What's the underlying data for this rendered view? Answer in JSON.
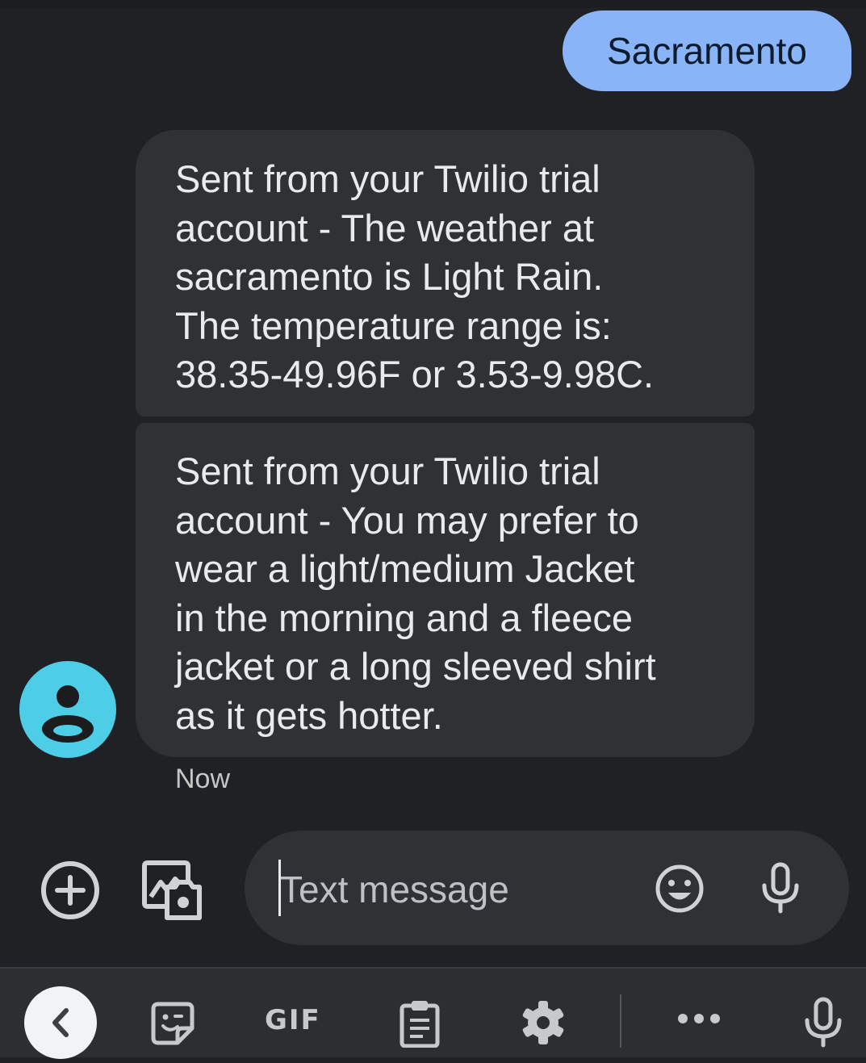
{
  "conversation": {
    "sent_message": "Sacramento",
    "received_messages": [
      "Sent from your Twilio trial\naccount - The weather at\nsacramento is Light Rain.\nThe temperature range is:\n38.35-49.96F or 3.53-9.98C.",
      "Sent from your Twilio trial\naccount - You may prefer to\nwear a light/medium Jacket\nin the morning and a fleece\njacket or a long sleeved shirt\nas it gets hotter."
    ],
    "timestamp": "Now"
  },
  "compose": {
    "placeholder": "Text message",
    "icons": [
      "add-circle-icon",
      "image-camera-icon",
      "emoji-icon",
      "mic-icon"
    ]
  },
  "keyboard_toolbar": {
    "gif_label": "GIF",
    "icons": [
      "back-chevron-icon",
      "sticker-icon",
      "clipboard-icon",
      "gear-icon",
      "more-icon",
      "mic-icon"
    ]
  },
  "colors": {
    "background": "#1f2125",
    "sent_bubble": "#8ab4f8",
    "received_bubble": "#303134",
    "avatar": "#4ecde6",
    "keyboard_bar": "#2c2e32"
  }
}
